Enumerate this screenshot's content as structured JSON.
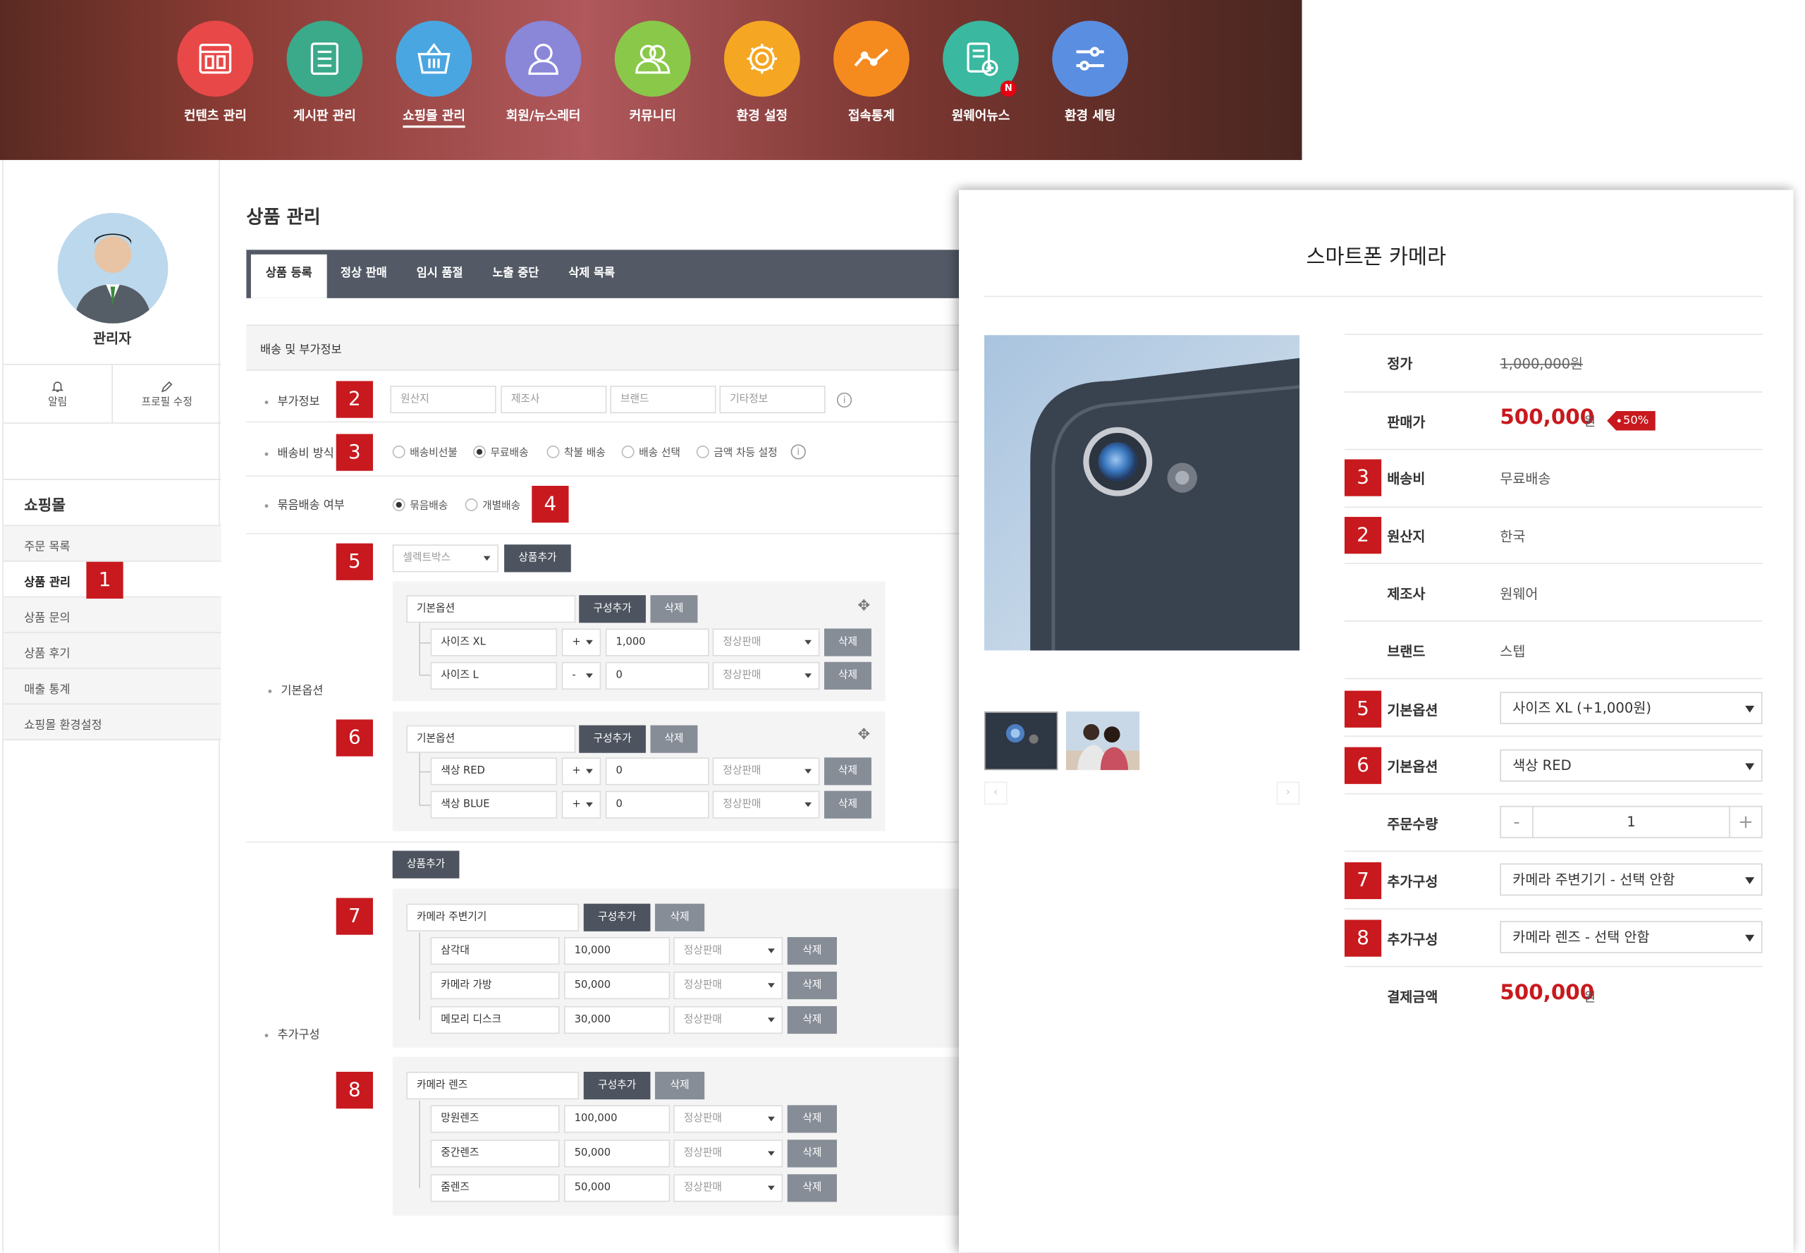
{
  "nav": [
    {
      "label": "컨텐츠 관리",
      "color": "#e84848",
      "icon": "layout-icon"
    },
    {
      "label": "게시판 관리",
      "color": "#3aaa8a",
      "icon": "list-icon"
    },
    {
      "label": "쇼핑몰 관리",
      "color": "#4aa6e0",
      "icon": "basket-icon",
      "active": true
    },
    {
      "label": "회원/뉴스레터",
      "color": "#8a86d8",
      "icon": "user-icon"
    },
    {
      "label": "커뮤니티",
      "color": "#8ac84a",
      "icon": "users-icon"
    },
    {
      "label": "환경 설정",
      "color": "#f5a623",
      "icon": "gear-icon"
    },
    {
      "label": "접속통계",
      "color": "#f58a1f",
      "icon": "chart-icon"
    },
    {
      "label": "원웨어뉴스",
      "color": "#3ab8a0",
      "icon": "news-icon",
      "badge": "N"
    },
    {
      "label": "환경 세팅",
      "color": "#5a8ee0",
      "icon": "sliders-icon"
    }
  ],
  "sidebar": {
    "name": "관리자",
    "tools": [
      "알림",
      "프로필 수정"
    ],
    "section": "쇼핑몰",
    "items": [
      "주문 목록",
      "상품 관리",
      "상품 문의",
      "상품 후기",
      "매출 통계",
      "쇼핑몰 환경설정"
    ]
  },
  "main": {
    "title": "상품 관리",
    "tabs": [
      "상품 등록",
      "정상 판매",
      "임시 품절",
      "노출 중단",
      "삭제 목록"
    ],
    "section_title": "배송 및 부가정보",
    "extra": {
      "label": "부가정보",
      "placeholders": [
        "원산지",
        "제조사",
        "브랜드",
        "기타정보"
      ]
    },
    "shipping": {
      "label": "배송비 방식",
      "options": [
        "배송비선불",
        "무료배송",
        "착불 배송",
        "배송 선택",
        "금액 차등 설정"
      ]
    },
    "bundle": {
      "label": "묶음배송 여부",
      "options": [
        "묶음배송",
        "개별배송"
      ]
    },
    "basic_label": "기본옵션",
    "select_box": "셀렉트박스",
    "add_product": "상품추가",
    "compose_add": "구성추가",
    "delete": "삭제",
    "groups1": [
      {
        "name": "기본옵션",
        "rows": [
          {
            "name": "사이즈 XL",
            "sign": "+",
            "price": "1,000",
            "status": "정상판매"
          },
          {
            "name": "사이즈 L",
            "sign": "-",
            "price": "0",
            "status": "정상판매"
          }
        ]
      },
      {
        "name": "기본옵션",
        "rows": [
          {
            "name": "색상 RED",
            "sign": "+",
            "price": "0",
            "status": "정상판매"
          },
          {
            "name": "색상 BLUE",
            "sign": "+",
            "price": "0",
            "status": "정상판매"
          }
        ]
      }
    ],
    "addon_label": "추가구성",
    "groups2": [
      {
        "name": "카메라 주변기기",
        "rows": [
          {
            "name": "삼각대",
            "price": "10,000",
            "status": "정상판매"
          },
          {
            "name": "카메라 가방",
            "price": "50,000",
            "status": "정상판매"
          },
          {
            "name": "메모리 디스크",
            "price": "30,000",
            "status": "정상판매"
          }
        ]
      },
      {
        "name": "카메라 렌즈",
        "rows": [
          {
            "name": "망원렌즈",
            "price": "100,000",
            "status": "정상판매"
          },
          {
            "name": "중간렌즈",
            "price": "50,000",
            "status": "정상판매"
          },
          {
            "name": "줌렌즈",
            "price": "50,000",
            "status": "정상판매"
          }
        ]
      }
    ]
  },
  "markers": [
    "1",
    "2",
    "3",
    "4",
    "5",
    "6",
    "7",
    "8"
  ],
  "popup": {
    "title": "스마트폰 카메라",
    "list_price_label": "정가",
    "list_price": "1,000,000원",
    "sale_label": "판매가",
    "sale_price": "500,000",
    "won": "원",
    "discount": "50%",
    "ship_label": "배송비",
    "ship": "무료배송",
    "origin_label": "원산지",
    "origin": "한국",
    "maker_label": "제조사",
    "maker": "원웨어",
    "brand_label": "브랜드",
    "brand": "스텝",
    "opt1_label": "기본옵션",
    "opt1": "사이즈 XL (+1,000원)",
    "opt2_label": "기본옵션",
    "opt2": "색상 RED",
    "qty_label": "주문수량",
    "qty": "1",
    "minus": "-",
    "plus": "+",
    "add1_label": "추가구성",
    "add1": "카메라 주변기기 - 선택 안함",
    "add2_label": "추가구성",
    "add2": "카메라 렌즈 - 선택 안함",
    "total_label": "결제금액",
    "total": "500,000"
  }
}
